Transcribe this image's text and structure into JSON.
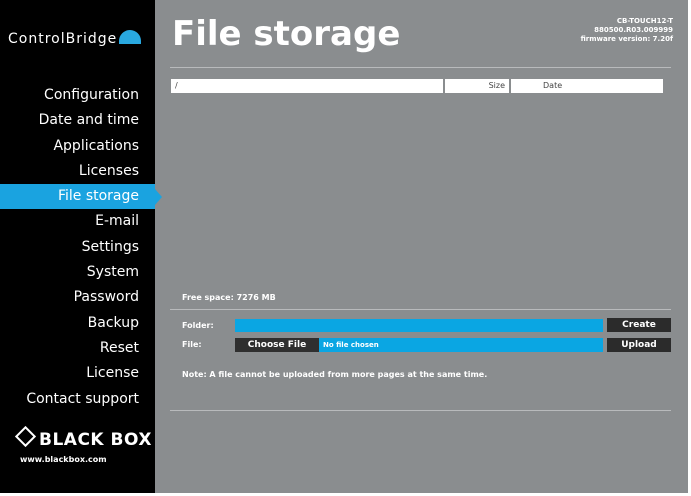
{
  "brand": {
    "logo_text": "ControlBridge",
    "blackbox_text": "BLACK BOX",
    "blackbox_url": "www.blackbox.com"
  },
  "header": {
    "title": "File storage",
    "device": "CB-TOUCH12-T",
    "serial": "880500.R03.009999",
    "firmware": "firmware version: 7.20f"
  },
  "nav": {
    "items": [
      {
        "label": "Configuration"
      },
      {
        "label": "Date and time"
      },
      {
        "label": "Applications"
      },
      {
        "label": "Licenses"
      },
      {
        "label": "File storage",
        "active": true
      },
      {
        "label": "E-mail"
      },
      {
        "label": "Settings"
      },
      {
        "label": "System"
      },
      {
        "label": "Password"
      },
      {
        "label": "Backup"
      },
      {
        "label": "Reset"
      },
      {
        "label": "License"
      },
      {
        "label": "Contact support"
      }
    ]
  },
  "table": {
    "columns": {
      "name": "/",
      "size": "Size",
      "date": "Date"
    }
  },
  "storage": {
    "free_space": "Free space: 7276 MB",
    "folder_label": "Folder:",
    "file_label": "File:",
    "folder_value": "",
    "choose_file_label": "Choose File",
    "file_status": "No file chosen",
    "create_label": "Create",
    "upload_label": "Upload",
    "note": "Note: A file cannot be uploaded from more pages at the same time."
  },
  "colors": {
    "background": "#8a8d8f",
    "accent": "#1aa3e0",
    "sidebar": "#000000"
  }
}
